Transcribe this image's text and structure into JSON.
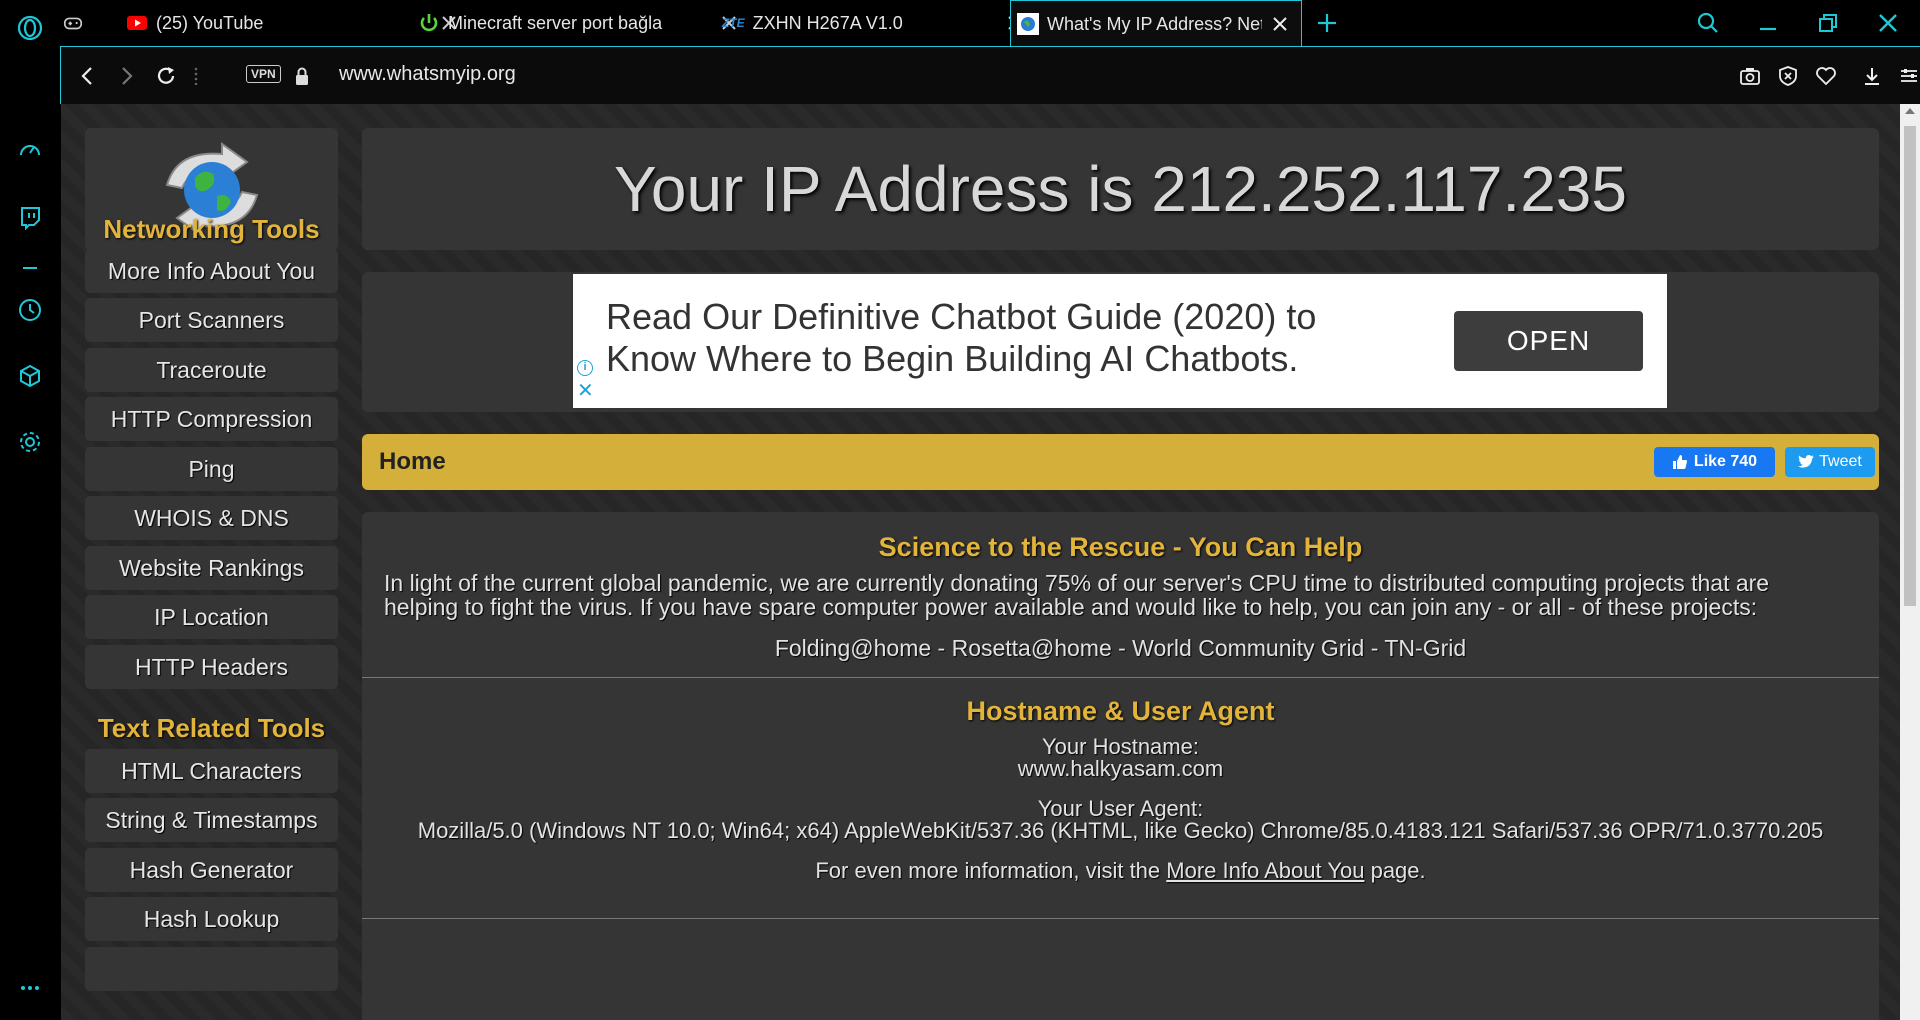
{
  "browser": {
    "tabs": [
      {
        "title": "(25) YouTube",
        "icon": "youtube-icon"
      },
      {
        "title": "Minecraft server port bağla",
        "icon": "power-icon"
      },
      {
        "title": "ZXHN H267A V1.0",
        "icon": "zte-logo",
        "logo_text": "ZTE"
      },
      {
        "title": "What's My IP Address? Net",
        "icon": "globe-favicon",
        "active": true
      }
    ],
    "url": "www.whatsmyip.org",
    "vpn_label": "VPN",
    "accent_color": "#1ec8d6"
  },
  "sidebar": {
    "left_nav": {
      "networking_heading": "Networking Tools",
      "networking_links": [
        "More Info About You",
        "Port Scanners",
        "Traceroute",
        "HTTP Compression",
        "Ping",
        "WHOIS & DNS",
        "Website Rankings",
        "IP Location",
        "HTTP Headers"
      ],
      "text_heading": "Text Related Tools",
      "text_links": [
        "HTML Characters",
        "String & Timestamps",
        "Hash Generator",
        "Hash Lookup"
      ]
    }
  },
  "main": {
    "ip_banner": "Your IP Address is 212.252.117.235",
    "ad": {
      "line1": "Read Our Definitive Chatbot Guide (2020) to",
      "line2": "Know Where to Begin Building AI Chatbots.",
      "button": "OPEN"
    },
    "home_bar": {
      "title": "Home",
      "like_label": "Like 740",
      "tweet_label": "Tweet"
    },
    "science": {
      "title": "Science to the Rescue - You Can Help",
      "line1": "In light of the current global pandemic, we are currently donating 75% of our server's CPU time to distributed computing projects that are",
      "line2": "helping to fight the virus. If you have spare computer power available and would like to help, you can join any - or all - of these projects:",
      "projects": "Folding@home - Rosetta@home - World Community Grid - TN-Grid"
    },
    "hostname": {
      "title": "Hostname & User Agent",
      "host_label": "Your Hostname:",
      "host_value": "www.halkyasam.com",
      "ua_label": "Your User Agent:",
      "ua_value": "Mozilla/5.0 (Windows NT 10.0; Win64; x64) AppleWebKit/537.36 (KHTML, like Gecko) Chrome/85.0.4183.121 Safari/537.36 OPR/71.0.3770.205",
      "more_prefix": "For even more information, visit the",
      "more_link": "More Info About You",
      "more_suffix": "page."
    }
  }
}
